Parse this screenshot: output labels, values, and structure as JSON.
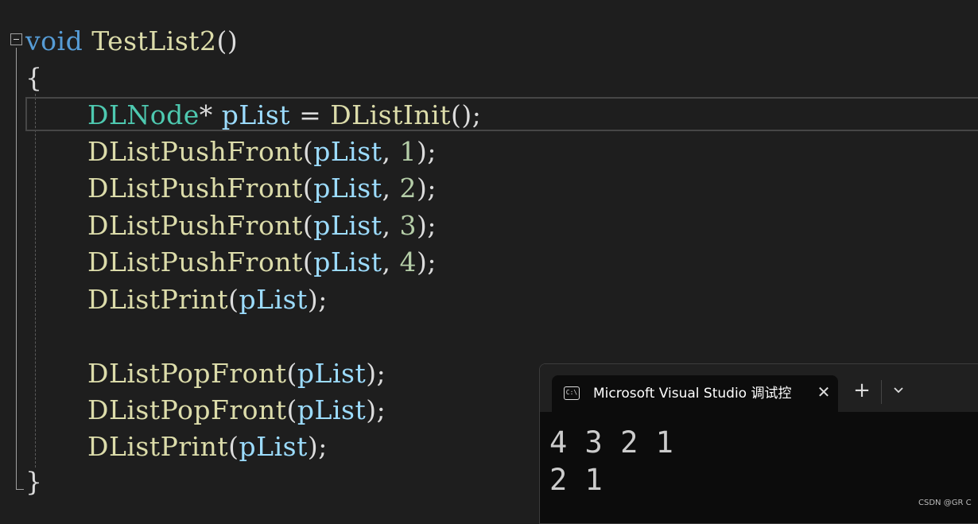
{
  "code": {
    "line1": {
      "kw": "void",
      "fn": "TestList2",
      "paren": "()"
    },
    "line2": "{",
    "line3": {
      "type": "DLNode",
      "star": "* ",
      "var": "pList",
      "eq": " = ",
      "fn": "DListInit",
      "end": "();"
    },
    "push_front_calls": [
      {
        "fn": "DListPushFront",
        "open": "(",
        "var": "pList",
        "comma": ", ",
        "num": "1",
        "close": ");"
      },
      {
        "fn": "DListPushFront",
        "open": "(",
        "var": "pList",
        "comma": ", ",
        "num": "2",
        "close": ");"
      },
      {
        "fn": "DListPushFront",
        "open": "(",
        "var": "pList",
        "comma": ", ",
        "num": "3",
        "close": ");"
      },
      {
        "fn": "DListPushFront",
        "open": "(",
        "var": "pList",
        "comma": ", ",
        "num": "4",
        "close": ");"
      }
    ],
    "print1": {
      "fn": "DListPrint",
      "open": "(",
      "var": "pList",
      "close": ");"
    },
    "pop_calls": [
      {
        "fn": "DListPopFront",
        "open": "(",
        "var": "pList",
        "close": ");"
      },
      {
        "fn": "DListPopFront",
        "open": "(",
        "var": "pList",
        "close": ");"
      }
    ],
    "print2": {
      "fn": "DListPrint",
      "open": "(",
      "var": "pList",
      "close": ");"
    },
    "close_brace": "}"
  },
  "terminal": {
    "icon_text": "C:\\",
    "tab_title": "Microsoft Visual Studio 调试控制台",
    "close": "✕",
    "new_tab": "+",
    "output": [
      "4 3 2 1",
      "2 1"
    ]
  },
  "watermark": "CSDN @GR C",
  "colors": {
    "keyword": "#569cd6",
    "function": "#dcdcaa",
    "type": "#4ec9b0",
    "variable": "#9cdcfe",
    "number": "#b5cea8",
    "editor_bg": "#1e1e1e",
    "terminal_bg": "#0c0c0c"
  }
}
